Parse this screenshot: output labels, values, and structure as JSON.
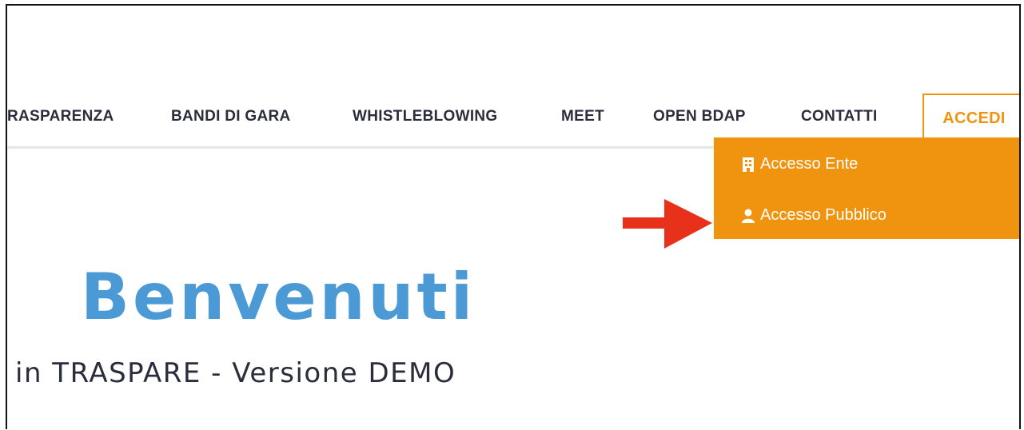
{
  "nav": {
    "items": [
      {
        "label": "RASPARENZA"
      },
      {
        "label": "BANDI DI GARA"
      },
      {
        "label": "WHISTLEBLOWING"
      },
      {
        "label": "MEET"
      },
      {
        "label": "OPEN BDAP"
      },
      {
        "label": "CONTATTI"
      }
    ],
    "accedi_label": "ACCEDI"
  },
  "dropdown": {
    "items": [
      {
        "label": "Accesso Ente",
        "icon": "building-icon"
      },
      {
        "label": "Accesso Pubblico",
        "icon": "user-icon"
      }
    ]
  },
  "hero": {
    "title": "Benvenuti",
    "subtitle": "in TRASPARE - Versione DEMO"
  },
  "colors": {
    "accent": "#f0940f",
    "nav_text": "#2b2d3c",
    "title_blue": "#4b9ad6",
    "arrow_red": "#e8311a"
  }
}
